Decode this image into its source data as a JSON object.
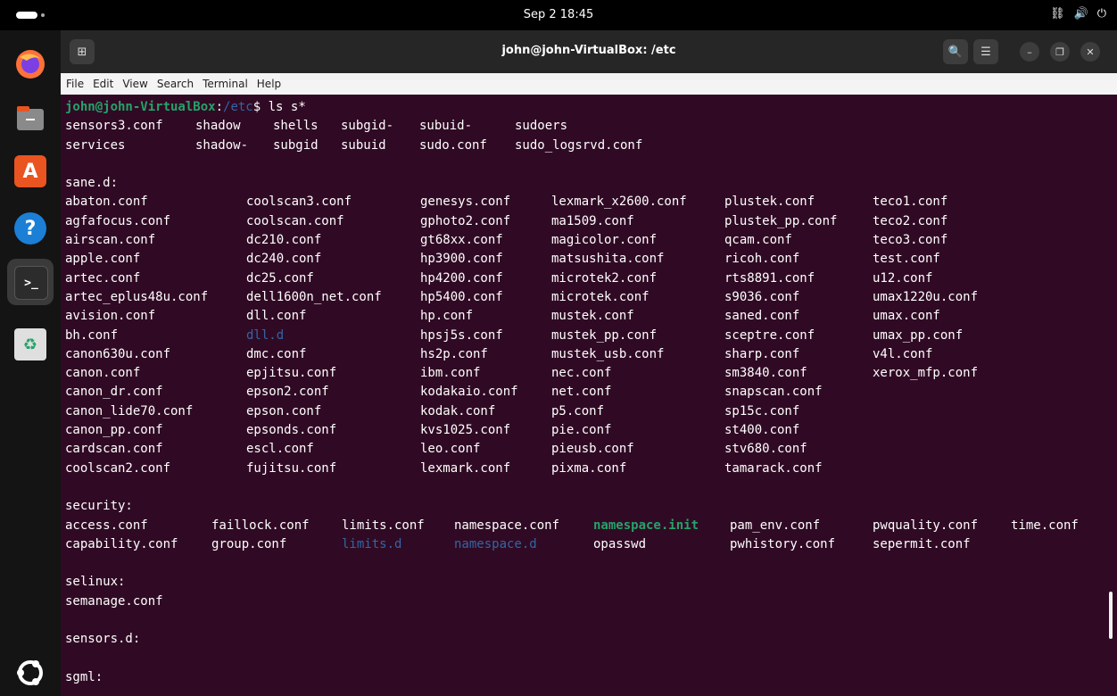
{
  "topbar": {
    "clock": "Sep 2  18:45",
    "tray": {
      "network_icon": "⛓",
      "volume_icon": "🔊",
      "power_icon": "⏻"
    }
  },
  "dock": {
    "items": [
      {
        "name": "firefox",
        "glyph": ""
      },
      {
        "name": "files",
        "glyph": "▬"
      },
      {
        "name": "app-center",
        "glyph": "A"
      },
      {
        "name": "help",
        "glyph": "?"
      },
      {
        "name": "terminal",
        "glyph": ">_"
      },
      {
        "name": "trash",
        "glyph": "♻"
      }
    ]
  },
  "window": {
    "title": "john@john-VirtualBox: /etc",
    "newtab_glyph": "⊞",
    "search_glyph": "🔍",
    "menu_glyph": "☰",
    "minimize_glyph": "–",
    "maximize_glyph": "❐",
    "close_glyph": "✕"
  },
  "menubar": [
    "File",
    "Edit",
    "View",
    "Search",
    "Terminal",
    "Help"
  ],
  "terminal": {
    "prompt": {
      "user": "john@john-VirtualBox",
      "sep": ":",
      "path": "/etc",
      "dollar": "$",
      "cmd": " ls s*"
    },
    "cols_top": [
      0,
      146,
      233,
      309,
      397,
      504
    ],
    "top_lines": [
      [
        "sensors3.conf",
        "shadow",
        "shells",
        "subgid-",
        "subuid-",
        "sudoers"
      ],
      [
        "services",
        "shadow-",
        "subgid",
        "subuid",
        "sudo.conf",
        "sudo_logsrvd.conf"
      ]
    ],
    "sane_header": "sane.d:",
    "sane_cols": [
      0,
      203,
      398,
      545,
      739,
      905
    ],
    "sane_rows": [
      [
        "abaton.conf",
        "coolscan3.conf",
        "genesys.conf",
        "lexmark_x2600.conf",
        "plustek.conf",
        "teco1.conf"
      ],
      [
        "agfafocus.conf",
        "coolscan.conf",
        "gphoto2.conf",
        "ma1509.conf",
        "plustek_pp.conf",
        "teco2.conf"
      ],
      [
        "airscan.conf",
        "dc210.conf",
        "gt68xx.conf",
        "magicolor.conf",
        "qcam.conf",
        "teco3.conf"
      ],
      [
        "apple.conf",
        "dc240.conf",
        "hp3900.conf",
        "matsushita.conf",
        "ricoh.conf",
        "test.conf"
      ],
      [
        "artec.conf",
        "dc25.conf",
        "hp4200.conf",
        "microtek2.conf",
        "rts8891.conf",
        "u12.conf"
      ],
      [
        "artec_eplus48u.conf",
        "dell1600n_net.conf",
        "hp5400.conf",
        "microtek.conf",
        "s9036.conf",
        "umax1220u.conf"
      ],
      [
        "avision.conf",
        "dll.conf",
        "hp.conf",
        "mustek.conf",
        "saned.conf",
        "umax.conf"
      ],
      [
        "bh.conf",
        "dll.d",
        "hpsj5s.conf",
        "mustek_pp.conf",
        "sceptre.conf",
        "umax_pp.conf"
      ],
      [
        "canon630u.conf",
        "dmc.conf",
        "hs2p.conf",
        "mustek_usb.conf",
        "sharp.conf",
        "v4l.conf"
      ],
      [
        "canon.conf",
        "epjitsu.conf",
        "ibm.conf",
        "nec.conf",
        "sm3840.conf",
        "xerox_mfp.conf"
      ],
      [
        "canon_dr.conf",
        "epson2.conf",
        "kodakaio.conf",
        "net.conf",
        "snapscan.conf",
        ""
      ],
      [
        "canon_lide70.conf",
        "epson.conf",
        "kodak.conf",
        "p5.conf",
        "sp15c.conf",
        ""
      ],
      [
        "canon_pp.conf",
        "epsonds.conf",
        "kvs1025.conf",
        "pie.conf",
        "st400.conf",
        ""
      ],
      [
        "cardscan.conf",
        "escl.conf",
        "leo.conf",
        "pieusb.conf",
        "stv680.conf",
        ""
      ],
      [
        "coolscan2.conf",
        "fujitsu.conf",
        "lexmark.conf",
        "pixma.conf",
        "tamarack.conf",
        ""
      ]
    ],
    "security_header": "security:",
    "sec_cols": [
      0,
      164,
      310,
      436,
      592,
      745,
      905,
      1060
    ],
    "sec_rows": [
      [
        "access.conf",
        "faillock.conf",
        "limits.conf",
        "namespace.conf",
        "namespace.init",
        "pam_env.conf",
        "pwquality.conf",
        "time.conf"
      ],
      [
        "capability.conf",
        "group.conf",
        "limits.d",
        "namespace.d",
        "opasswd",
        "pwhistory.conf",
        "sepermit.conf",
        ""
      ]
    ],
    "selinux_header": "selinux:",
    "selinux_file": "semanage.conf",
    "sensors_header": "sensors.d:",
    "sgml_header": "sgml:"
  }
}
